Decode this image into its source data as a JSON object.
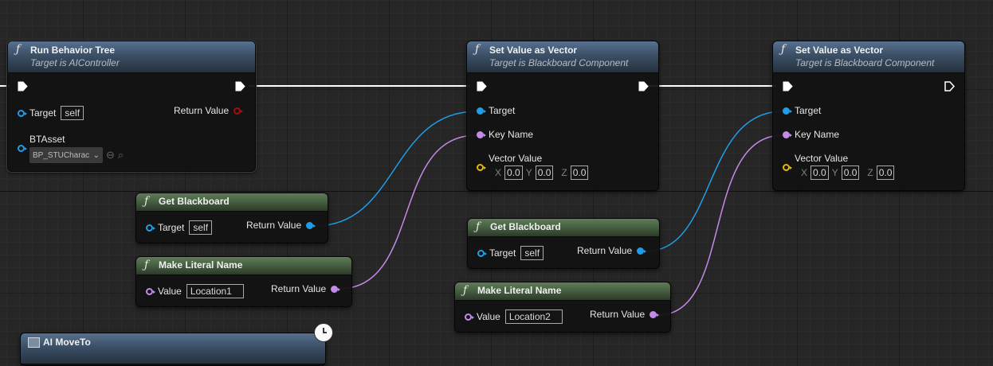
{
  "nodes": {
    "run_bt": {
      "title": "Run Behavior Tree",
      "subtitle": "Target is AIController",
      "target_label": "Target",
      "target_value": "self",
      "return_label": "Return Value",
      "btasset_label": "BTAsset",
      "btasset_value": "BP_STUCharac"
    },
    "set_vec_1": {
      "title": "Set Value as Vector",
      "subtitle": "Target is Blackboard Component",
      "target_label": "Target",
      "key_label": "Key Name",
      "vector_label": "Vector Value",
      "x_label": "X",
      "x_value": "0.0",
      "y_label": "Y",
      "y_value": "0.0",
      "z_label": "Z",
      "z_value": "0.0"
    },
    "set_vec_2": {
      "title": "Set Value as Vector",
      "subtitle": "Target is Blackboard Component",
      "target_label": "Target",
      "key_label": "Key Name",
      "vector_label": "Vector Value",
      "x_label": "X",
      "x_value": "0.0",
      "y_label": "Y",
      "y_value": "0.0",
      "z_label": "Z",
      "z_value": "0.0"
    },
    "get_bb_1": {
      "title": "Get Blackboard",
      "target_label": "Target",
      "target_value": "self",
      "return_label": "Return Value"
    },
    "get_bb_2": {
      "title": "Get Blackboard",
      "target_label": "Target",
      "target_value": "self",
      "return_label": "Return Value"
    },
    "lit_name_1": {
      "title": "Make Literal Name",
      "value_label": "Value",
      "value": "Location1",
      "return_label": "Return Value"
    },
    "lit_name_2": {
      "title": "Make Literal Name",
      "value_label": "Value",
      "value": "Location2",
      "return_label": "Return Value"
    },
    "ai_moveto": {
      "title": "AI MoveTo"
    }
  },
  "icons": {
    "function": "function-icon",
    "exec_pin": "exec-pin-icon",
    "object_pin": "object-pin-icon",
    "name_pin": "name-pin-icon",
    "vector_pin": "vector-pin-icon",
    "clock": "clock-icon"
  },
  "colors": {
    "object_pin": "#1f9ee8",
    "name_pin": "#c48ae8",
    "vector_pin": "#e6b800",
    "return_red": "#9a1212",
    "exec_wire": "#ffffff"
  }
}
